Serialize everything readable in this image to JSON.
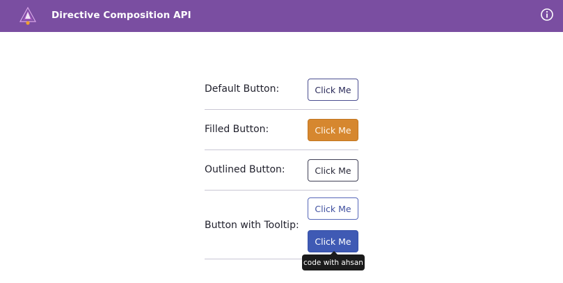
{
  "header": {
    "title": "Directive Composition API",
    "logo_icon": "angular-logo-icon",
    "info_icon": "info-circle-icon",
    "background": "#7a4ea1"
  },
  "rows": [
    {
      "label": "Default Button:",
      "buttons": [
        "Click Me"
      ],
      "style": "default"
    },
    {
      "label": "Filled Button:",
      "buttons": [
        "Click Me"
      ],
      "style": "filled",
      "color": "#d6872f"
    },
    {
      "label": "Outlined Button:",
      "buttons": [
        "Click Me"
      ],
      "style": "outlined"
    },
    {
      "label": "Button with Tooltip:",
      "buttons": [
        "Click Me",
        "Click Me"
      ],
      "style": "tooltip",
      "color": "#3f5ab4"
    }
  ],
  "tooltip": {
    "text": "code with ahsan"
  }
}
